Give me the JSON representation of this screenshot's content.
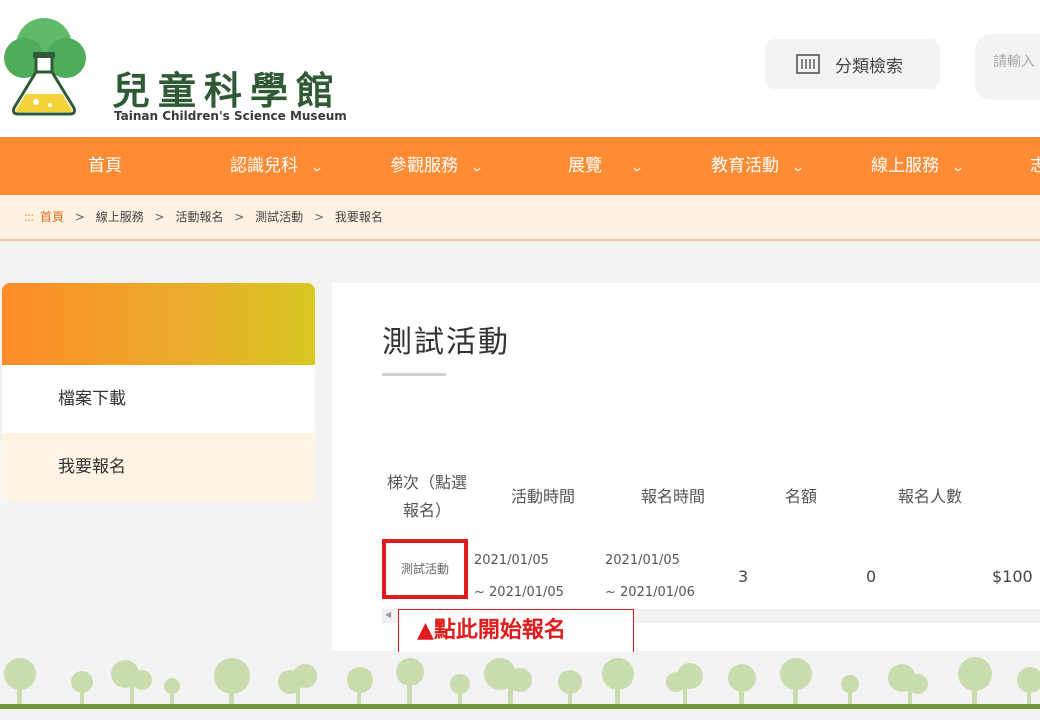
{
  "header": {
    "logo_title": "兒童科學館",
    "logo_subtitle": "Tainan Children's Science Museum",
    "category_search_label": "分類檢索",
    "search_placeholder": "請輸入"
  },
  "nav": {
    "items": [
      {
        "label": "首頁",
        "chevron": false
      },
      {
        "label": "認識兒科",
        "chevron": true
      },
      {
        "label": "參觀服務",
        "chevron": true
      },
      {
        "label": "展覽",
        "chevron": true
      },
      {
        "label": "教育活動",
        "chevron": true
      },
      {
        "label": "線上服務",
        "chevron": true
      },
      {
        "label": "志",
        "chevron": false
      }
    ],
    "chevron_glyph": "⌄"
  },
  "breadcrumb": {
    "home_icon": ":::",
    "items": [
      "首頁",
      "線上服務",
      "活動報名",
      "測試活動",
      "我要報名"
    ],
    "separator": ">"
  },
  "sidebar": {
    "items": [
      {
        "label": "檔案下載",
        "active": false
      },
      {
        "label": "我要報名",
        "active": true
      }
    ]
  },
  "main": {
    "title": "測試活動",
    "table": {
      "headers": {
        "session_line1": "梯次（點選",
        "session_line2": "報名）",
        "activity_time": "活動時間",
        "registration_time": "報名時間",
        "quota": "名額",
        "registrants": "報名人數"
      },
      "row": {
        "session": "測試活動",
        "activity_start": "2021/01/05",
        "activity_end": "~ 2021/01/05",
        "registration_start": "2021/01/05",
        "registration_end": "~ 2021/01/06",
        "quota": "3",
        "registrants": "0",
        "fee": "$100"
      }
    },
    "callout": "▲點此開始報名"
  },
  "colors": {
    "nav_orange": "#ff8c35",
    "breadcrumb_bg": "#fff2e3",
    "highlight_red": "#e11b1b",
    "logo_green": "#2f5a35"
  }
}
